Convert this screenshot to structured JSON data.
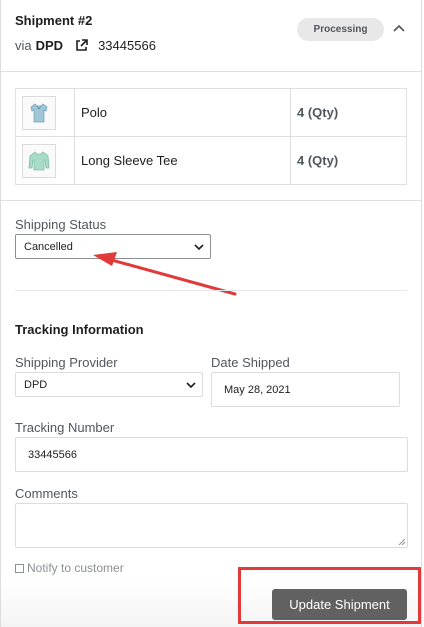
{
  "shipment": {
    "title": "Shipment #2",
    "via_label": "via",
    "carrier": "DPD",
    "tracking_number": "33445566",
    "status": "Processing"
  },
  "items": [
    {
      "name": "Polo",
      "qty": "4 (Qty)",
      "icon": "polo-shirt-thumbnail"
    },
    {
      "name": "Long Sleeve Tee",
      "qty": "4 (Qty)",
      "icon": "long-sleeve-tee-thumbnail"
    }
  ],
  "shipping_status": {
    "label": "Shipping Status",
    "value": "Cancelled"
  },
  "tracking": {
    "section_title": "Tracking Information",
    "provider_label": "Shipping Provider",
    "provider_value": "DPD",
    "date_label": "Date Shipped",
    "date_value": "May 28, 2021",
    "number_label": "Tracking Number",
    "number_value": "33445566",
    "comments_label": "Comments",
    "comments_value": ""
  },
  "notify": {
    "label": "Notify to customer",
    "checked": false
  },
  "actions": {
    "update_label": "Update Shipment"
  },
  "colors": {
    "annotation_red": "#e23a3a",
    "button_bg": "#616161",
    "pill_bg": "#e8e8e8"
  }
}
